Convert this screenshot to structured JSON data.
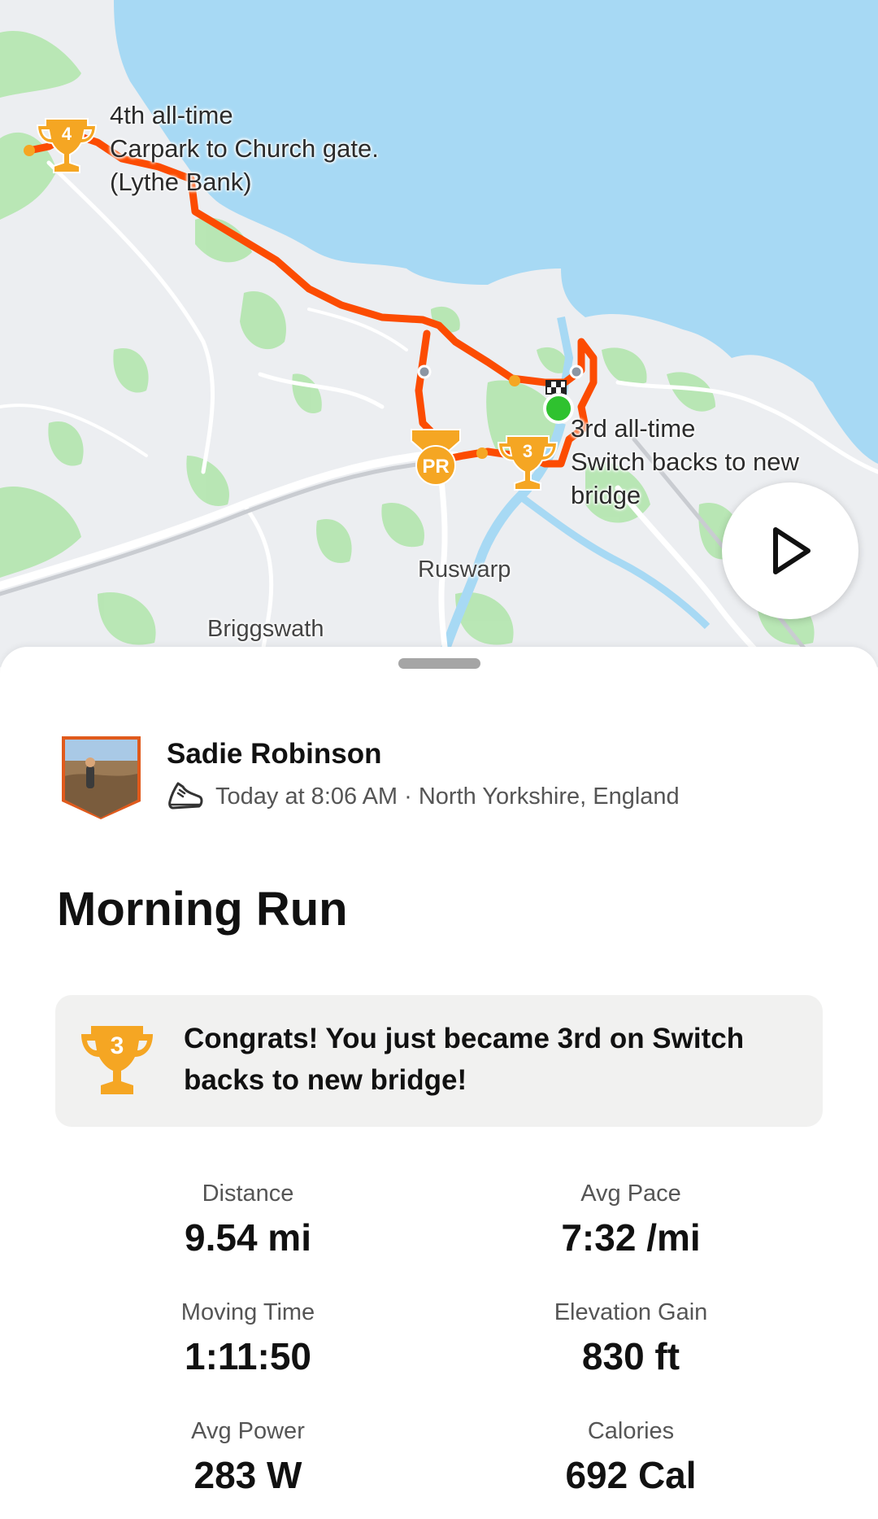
{
  "map": {
    "place_labels": [
      "Ruswarp",
      "Briggswath"
    ],
    "segments": [
      {
        "rank_badge": "4",
        "line1": "4th all-time",
        "line2": "Carpark to Church gate.",
        "line3": "(Lythe Bank)"
      },
      {
        "rank_badge": "3",
        "line1": "3rd all-time",
        "line2": "Switch backs to new",
        "line3": "bridge"
      }
    ],
    "pr_badge": "PR",
    "route_color": "#fc4c02",
    "trophy_color": "#f5a623",
    "sea_color": "#a7d9f4",
    "green_color": "#b6e6b1"
  },
  "athlete": {
    "name": "Sadie Robinson",
    "meta": "Today at 8:06 AM · North Yorkshire, England",
    "activity_icon": "running-shoe-icon"
  },
  "activity": {
    "title": "Morning Run"
  },
  "achievement": {
    "rank_badge": "3",
    "text": "Congrats! You just became 3rd on Switch backs to new bridge!"
  },
  "stats": [
    {
      "label": "Distance",
      "value": "9.54 mi"
    },
    {
      "label": "Avg Pace",
      "value": "7:32 /mi"
    },
    {
      "label": "Moving Time",
      "value": "1:11:50"
    },
    {
      "label": "Elevation Gain",
      "value": "830 ft"
    },
    {
      "label": "Avg Power",
      "value": "283 W"
    },
    {
      "label": "Calories",
      "value": "692 Cal"
    }
  ]
}
